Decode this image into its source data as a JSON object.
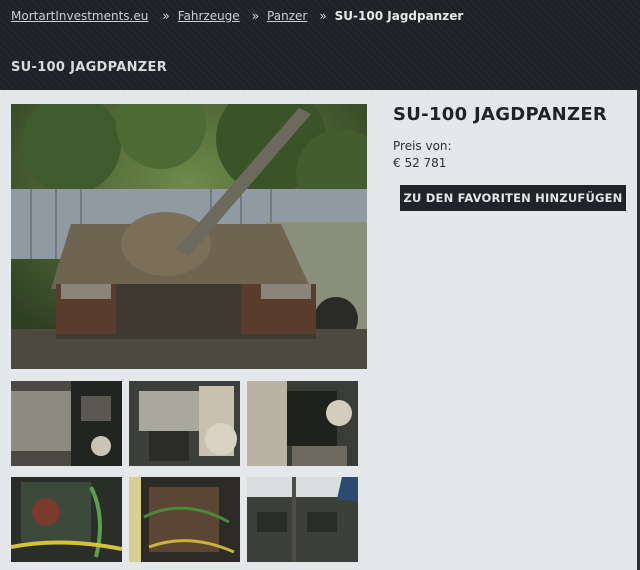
{
  "breadcrumb": {
    "home": "MortartInvestments.eu",
    "level1": "Fahrzeuge",
    "level2": "Panzer",
    "current": "SU-100 Jagdpanzer",
    "separator": "»"
  },
  "page_heading": "SU-100 JAGDPANZER",
  "product": {
    "title": "SU-100 JAGDPANZER",
    "price_label": "Preis von:",
    "price_value": "€ 52 781",
    "favorite_button_label": "ZU DEN FAVORITEN HINZUFÜGEN"
  },
  "gallery": {
    "main_image_icon": "tank-photo",
    "thumbnails": [
      "engine-bay-photo-1",
      "engine-bay-photo-2",
      "engine-bay-photo-3",
      "wiring-photo-1",
      "wiring-photo-2",
      "hull-photo"
    ]
  }
}
